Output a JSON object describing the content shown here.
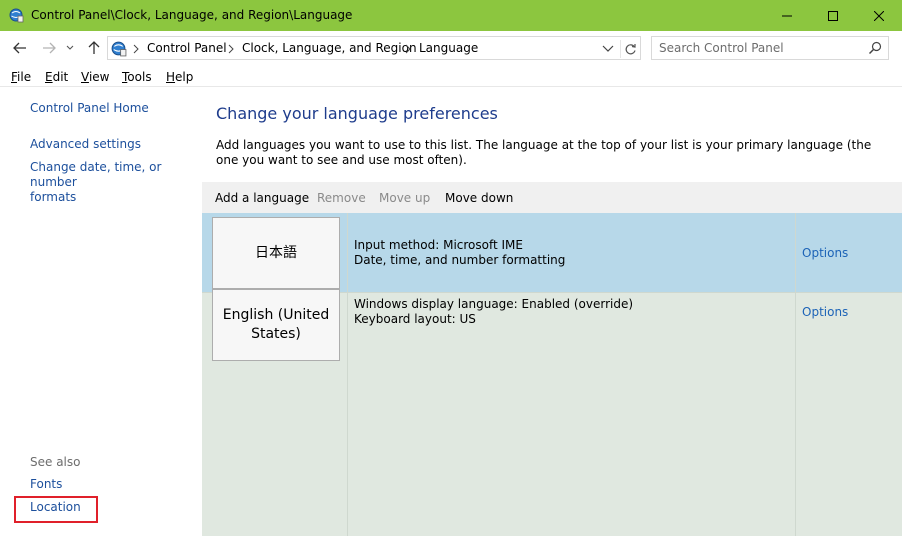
{
  "window": {
    "title": "Control Panel\\Clock, Language, and Region\\Language",
    "app_icon": "control-panel-icon",
    "title_bar_color": "#8cc63f"
  },
  "address": {
    "breadcrumbs": [
      "Control Panel",
      "Clock, Language, and Region",
      "Language"
    ],
    "search_placeholder": "Search Control Panel"
  },
  "menu": {
    "items": [
      {
        "label": "File",
        "accel": "F",
        "rest": "ile"
      },
      {
        "label": "Edit",
        "accel": "E",
        "rest": "dit"
      },
      {
        "label": "View",
        "accel": "V",
        "rest": "iew"
      },
      {
        "label": "Tools",
        "accel": "T",
        "rest": "ools"
      },
      {
        "label": "Help",
        "accel": "H",
        "rest": "elp"
      }
    ]
  },
  "sidebar": {
    "home": "Control Panel Home",
    "advanced": "Advanced settings",
    "datetime_line1": "Change date, time, or number",
    "datetime_line2": "formats",
    "see_also": "See also",
    "fonts": "Fonts",
    "location": "Location"
  },
  "main": {
    "title": "Change your language preferences",
    "description": "Add languages you want to use to this list. The language at the top of your list is your primary language (the one you want to see and use most often).",
    "toolbar": {
      "add": "Add a language",
      "remove": "Remove",
      "move_up": "Move up",
      "move_down": "Move down"
    },
    "languages": [
      {
        "name_line1": "日本語",
        "name_line2": "",
        "info_line1": "Input method: Microsoft IME",
        "info_line2": "Date, time, and number formatting",
        "options": "Options",
        "selected": true
      },
      {
        "name_line1": "English (United",
        "name_line2": "States)",
        "info_line1": "Windows display language: Enabled (override)",
        "info_line2": "Keyboard layout: US",
        "options": "Options",
        "selected": false
      }
    ]
  },
  "colors": {
    "link": "#1c4f9c",
    "heading": "#1e3c8c",
    "selected_row": "#b7d8e9",
    "list_background": "#e0e8e0",
    "highlight": "#e0202a"
  }
}
